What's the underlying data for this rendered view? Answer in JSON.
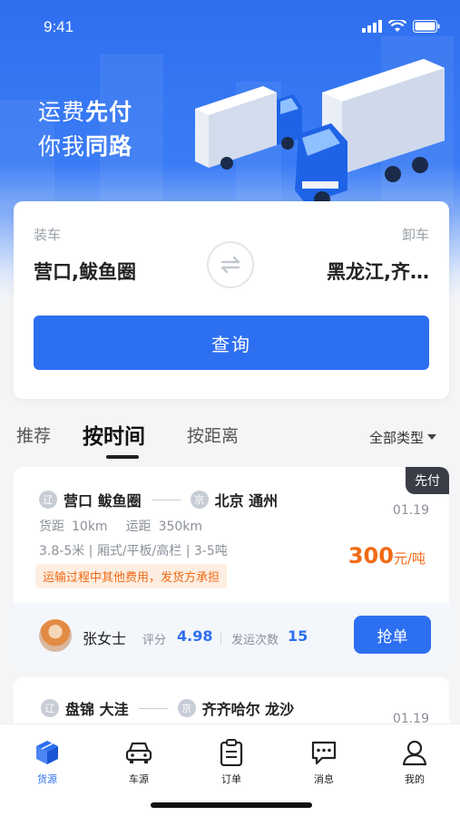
{
  "status_bar": {
    "time": "9:41"
  },
  "hero": {
    "slogan_line1_a": "运费",
    "slogan_line1_b": "先付",
    "slogan_line2_a": "你我",
    "slogan_line2_b": "同路"
  },
  "search": {
    "load_label": "装车",
    "load_city": "营口,鲅鱼圈",
    "unload_label": "卸车",
    "unload_city": "黑龙江,齐…",
    "query_button": "查询"
  },
  "tabs": [
    {
      "label": "推荐"
    },
    {
      "label": "按时间"
    },
    {
      "label": "按距离"
    }
  ],
  "filter": {
    "label": "全部类型"
  },
  "orders": [
    {
      "badge": "先付",
      "from_prov": "辽",
      "from": "营口 鲅鱼圈",
      "to_prov": "京",
      "to": "北京 通州",
      "goods_dist_label": "货距",
      "goods_dist": "10km",
      "ship_dist_label": "运距",
      "ship_dist": "350km",
      "spec": "3.8-5米 | 厢式/平板/高栏 | 3-5吨",
      "date": "01.19",
      "price": "300",
      "price_unit": "元/吨",
      "note": "运输过程中其他费用，发货方承担",
      "user_name": "张女士",
      "rating_label": "评分",
      "rating": "4.98",
      "shipments_label": "发运次数",
      "shipments": "15",
      "grab_button": "抢单"
    },
    {
      "from_prov": "辽",
      "from": "盘锦 大洼",
      "to_prov": "京",
      "to": "齐齐哈尔 龙沙",
      "date": "01.19"
    }
  ],
  "nav": [
    {
      "label": "货源",
      "icon": "cube-icon",
      "active": true
    },
    {
      "label": "车源",
      "icon": "car-icon"
    },
    {
      "label": "订单",
      "icon": "clipboard-icon"
    },
    {
      "label": "消息",
      "icon": "message-icon"
    },
    {
      "label": "我的",
      "icon": "user-icon"
    }
  ],
  "colors": {
    "primary": "#2d6ff1",
    "price": "#f06a14",
    "hero_top": "#2f6ff0"
  }
}
